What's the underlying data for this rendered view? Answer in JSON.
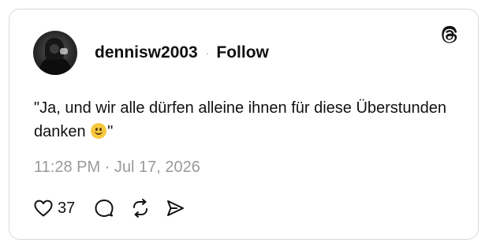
{
  "post": {
    "username": "dennisw2003",
    "separator": "·",
    "follow_label": "Follow",
    "text_before_emoji": "\"Ja, und wir alle dürfen alleine ihnen für diese Überstunden danken",
    "emoji": "🙂",
    "text_after_emoji": "\"",
    "timestamp": "11:28 PM · Jul 17, 2026",
    "like_count": "37"
  },
  "icons": {
    "brand": "threads-logo-icon",
    "like": "heart-icon",
    "reply": "comment-icon",
    "repost": "repost-icon",
    "share": "send-icon"
  },
  "colors": {
    "text": "#111111",
    "muted": "#9a9a9a",
    "border": "#d8d8d8",
    "background": "#ffffff"
  }
}
